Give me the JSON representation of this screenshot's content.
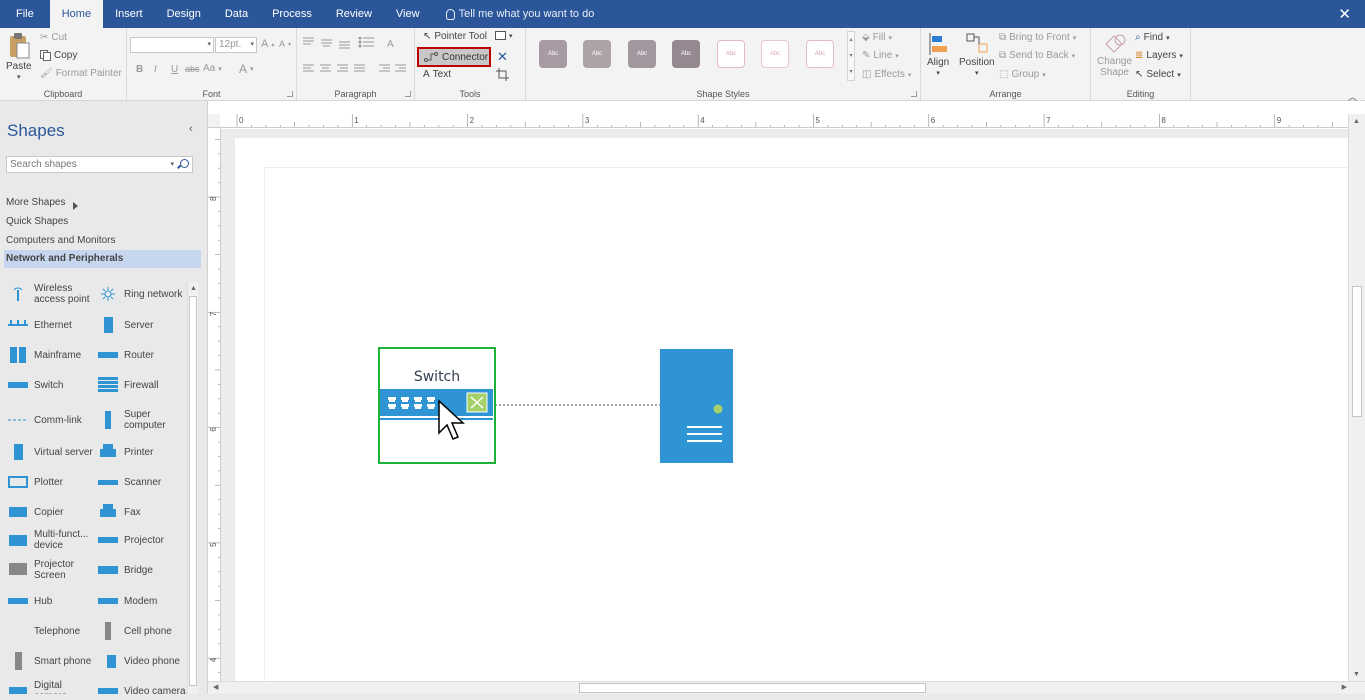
{
  "tabs": {
    "file": "File",
    "home": "Home",
    "insert": "Insert",
    "design": "Design",
    "data": "Data",
    "process": "Process",
    "review": "Review",
    "view": "View",
    "tell_me": "Tell me what you want to do"
  },
  "ribbon": {
    "clipboard": {
      "label": "Clipboard",
      "paste": "Paste",
      "cut": "Cut",
      "copy": "Copy",
      "format_painter": "Format Painter"
    },
    "font": {
      "label": "Font",
      "font_size": "12pt.",
      "bold": "B",
      "italic": "I",
      "underline": "U",
      "strikethrough": "abc",
      "case": "Aa",
      "font_color": "A",
      "grow": "A",
      "shrink": "A"
    },
    "paragraph": {
      "label": "Paragraph"
    },
    "tools": {
      "label": "Tools",
      "pointer_tool": "Pointer Tool",
      "connector": "Connector",
      "text": "Text"
    },
    "shape_styles": {
      "label": "Shape Styles",
      "sample": "Abc",
      "fill": "Fill",
      "line": "Line",
      "effects": "Effects"
    },
    "arrange": {
      "label": "Arrange",
      "align": "Align",
      "position": "Position",
      "bring_to_front": "Bring to Front",
      "send_to_back": "Send to Back",
      "group": "Group"
    },
    "editing": {
      "label": "Editing",
      "change_shape_1": "Change",
      "change_shape_2": "Shape",
      "find": "Find",
      "layers": "Layers",
      "select": "Select"
    }
  },
  "shapes_pane": {
    "title": "Shapes",
    "search_placeholder": "Search shapes",
    "more_shapes": "More Shapes",
    "quick_shapes": "Quick Shapes",
    "computers_monitors": "Computers and Monitors",
    "network_peripherals": "Network and Peripherals",
    "items": [
      [
        "Wireless",
        "access point"
      ],
      [
        "Ring network"
      ],
      [
        "Ethernet"
      ],
      [
        "Server"
      ],
      [
        "Mainframe"
      ],
      [
        "Router"
      ],
      [
        "Switch"
      ],
      [
        "Firewall"
      ],
      [
        "Comm-link"
      ],
      [
        "Super",
        "computer"
      ],
      [
        "Virtual server"
      ],
      [
        "Printer"
      ],
      [
        "Plotter"
      ],
      [
        "Scanner"
      ],
      [
        "Copier"
      ],
      [
        "Fax"
      ],
      [
        "Multi-funct...",
        "device"
      ],
      [
        "Projector"
      ],
      [
        "Projector",
        "Screen"
      ],
      [
        "Bridge"
      ],
      [
        "Hub"
      ],
      [
        "Modem"
      ],
      [
        "Telephone"
      ],
      [
        "Cell phone"
      ],
      [
        "Smart phone"
      ],
      [
        "Video phone"
      ],
      [
        "Digital",
        "camera"
      ],
      [
        "Video camera"
      ]
    ]
  },
  "canvas": {
    "switch_label": "Switch"
  },
  "ruler": {
    "h_labels": [
      "0",
      "1",
      "2",
      "3",
      "4",
      "5",
      "6",
      "7",
      "8",
      "9"
    ],
    "v_labels": [
      "8",
      "7",
      "6",
      "5",
      "4"
    ]
  },
  "colors": {
    "brand": "#2b579a",
    "shape_blue": "#2e94d4",
    "selection": "#1db33b",
    "highlight": "#c00000"
  }
}
